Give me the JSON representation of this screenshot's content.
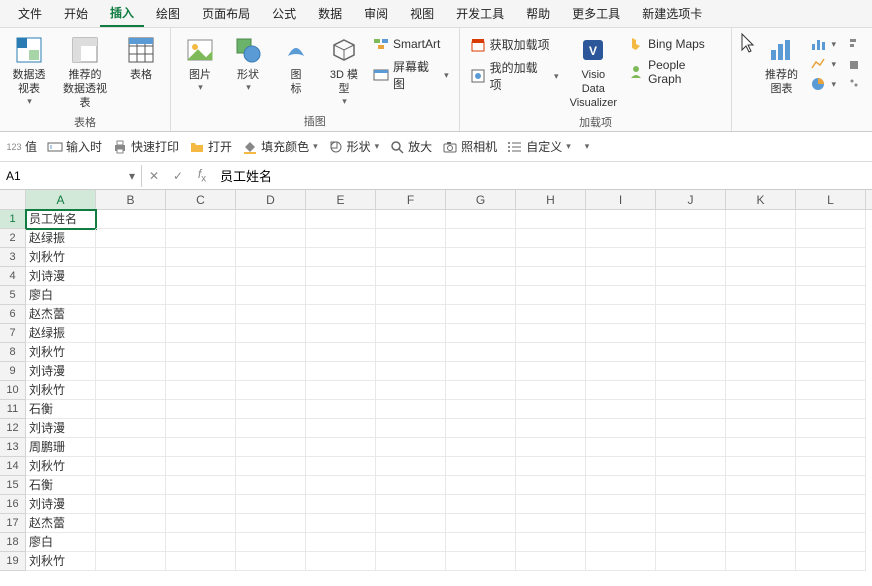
{
  "menu": {
    "items": [
      "文件",
      "开始",
      "插入",
      "绘图",
      "页面布局",
      "公式",
      "数据",
      "审阅",
      "视图",
      "开发工具",
      "帮助",
      "更多工具",
      "新建选项卡"
    ],
    "active": 2
  },
  "ribbon": {
    "group_tables": {
      "label": "表格",
      "pivot": "数据透\n视表",
      "recpivot": "推荐的\n数据透视表",
      "table": "表格"
    },
    "group_illus": {
      "label": "插图",
      "pic": "图片",
      "shapes": "形状",
      "icons": "图\n标",
      "model": "3D 模\n型",
      "smartart": "SmartArt",
      "screenshot": "屏幕截图"
    },
    "group_addins": {
      "label": "加载项",
      "getaddins": "获取加载项",
      "myaddins": "我的加载项",
      "visio_top": "Visio Data",
      "visio_bot": "Visualizer",
      "bing": "Bing Maps",
      "people": "People Graph"
    },
    "group_charts": {
      "recchart": "推荐的\n图表"
    }
  },
  "quickbar": {
    "val": "值",
    "input": "输入时",
    "print": "快速打印",
    "open": "打开",
    "fill": "填充颜色",
    "shape": "形状",
    "zoom": "放大",
    "camera": "照相机",
    "custom": "自定义"
  },
  "namebox": "A1",
  "formula": "员工姓名",
  "cols": [
    "A",
    "B",
    "C",
    "D",
    "E",
    "F",
    "G",
    "H",
    "I",
    "J",
    "K",
    "L"
  ],
  "sheet": {
    "rows": [
      {
        "n": 1,
        "a": "员工姓名"
      },
      {
        "n": 2,
        "a": "赵绿振"
      },
      {
        "n": 3,
        "a": "刘秋竹"
      },
      {
        "n": 4,
        "a": "刘诗漫"
      },
      {
        "n": 5,
        "a": "廖白"
      },
      {
        "n": 6,
        "a": "赵杰蕾"
      },
      {
        "n": 7,
        "a": "赵绿振"
      },
      {
        "n": 8,
        "a": "刘秋竹"
      },
      {
        "n": 9,
        "a": "刘诗漫"
      },
      {
        "n": 10,
        "a": "刘秋竹"
      },
      {
        "n": 11,
        "a": "石衡"
      },
      {
        "n": 12,
        "a": "刘诗漫"
      },
      {
        "n": 13,
        "a": "周鹏珊"
      },
      {
        "n": 14,
        "a": "刘秋竹"
      },
      {
        "n": 15,
        "a": "石衡"
      },
      {
        "n": 16,
        "a": "刘诗漫"
      },
      {
        "n": 17,
        "a": "赵杰蕾"
      },
      {
        "n": 18,
        "a": "廖白"
      },
      {
        "n": 19,
        "a": "刘秋竹"
      }
    ]
  }
}
